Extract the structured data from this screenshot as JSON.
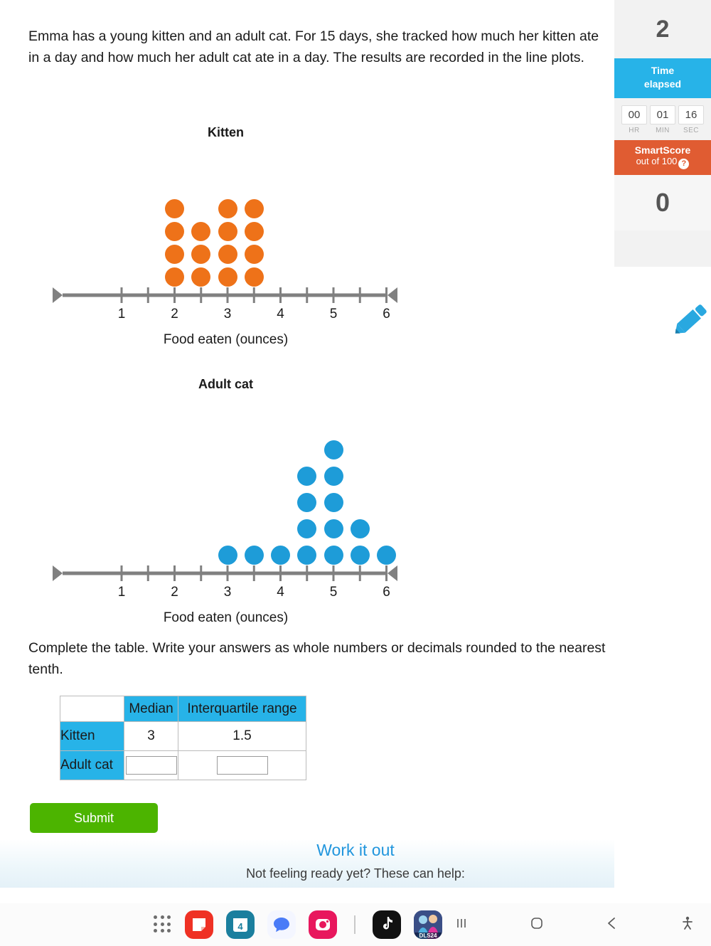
{
  "question": {
    "prompt": "Emma has a young kitten and an adult cat. For 15 days, she tracked how much her kitten ate in a day and how much her adult cat ate in a day. The results are recorded in the line plots.",
    "instruction": "Complete the table. Write your answers as whole numbers or decimals rounded to the nearest tenth."
  },
  "chart_data": [
    {
      "type": "scatter",
      "title": "Kitten",
      "xlabel": "Food eaten (ounces)",
      "ylabel": "",
      "xlim": [
        0.5,
        6.5
      ],
      "tick_labels": [
        "1",
        "2",
        "3",
        "4",
        "5",
        "6"
      ],
      "tick_values": [
        1,
        2,
        3,
        4,
        5,
        6
      ],
      "minor_tick_values": [
        1.5,
        2.5,
        3.5,
        4.5,
        5.5
      ],
      "dot_color": "#ee7219",
      "x": [
        2,
        2.5,
        3,
        3.5
      ],
      "counts": [
        4,
        3,
        4,
        4
      ],
      "total": 15,
      "grid": false,
      "legend": "none"
    },
    {
      "type": "scatter",
      "title": "Adult cat",
      "xlabel": "Food eaten (ounces)",
      "ylabel": "",
      "xlim": [
        0.5,
        6.5
      ],
      "tick_labels": [
        "1",
        "2",
        "3",
        "4",
        "5",
        "6"
      ],
      "tick_values": [
        1,
        2,
        3,
        4,
        5,
        6
      ],
      "minor_tick_values": [
        1.5,
        2.5,
        3.5,
        4.5,
        5.5
      ],
      "dot_color": "#1e9cd8",
      "x": [
        3,
        3.5,
        4,
        4.5,
        5,
        5.5,
        6
      ],
      "counts": [
        1,
        1,
        1,
        4,
        5,
        2,
        1
      ],
      "total": 15,
      "grid": false,
      "legend": "none"
    }
  ],
  "table": {
    "corner": "",
    "columns": [
      "Median",
      "Interquartile range"
    ],
    "rows": [
      {
        "label": "Kitten",
        "median": "3",
        "iqr": "1.5",
        "editable": false
      },
      {
        "label": "Adult cat",
        "median": "",
        "iqr": "",
        "editable": true
      }
    ]
  },
  "actions": {
    "submit_label": "Submit",
    "work_it_out": "Work it out",
    "help_line": "Not feeling ready yet? These can help:"
  },
  "sidebar": {
    "question_number": "2",
    "time_banner_line1": "Time",
    "time_banner_line2": "elapsed",
    "timer": [
      {
        "value": "00",
        "unit": "HR"
      },
      {
        "value": "01",
        "unit": "MIN"
      },
      {
        "value": "16",
        "unit": "SEC"
      }
    ],
    "smartscore_title": "SmartScore",
    "smartscore_sub": "out of 100",
    "smartscore_help": "?",
    "score": "0"
  },
  "pager": {
    "active_color": "#f5c40a",
    "inactive_color": "#dcdcdc"
  },
  "navbar": {
    "apps_icon": "app-grid-icon",
    "items": [
      {
        "name": "samsung-notes-icon",
        "color": "#ef3124"
      },
      {
        "name": "calendar-icon",
        "color": "#1b7f9e",
        "badge": "4"
      },
      {
        "name": "messages-icon",
        "color": "#4a7bf7"
      },
      {
        "name": "instagram-icon",
        "color": "#e8175d"
      },
      {
        "name": "tiktok-icon",
        "color": "#111111"
      },
      {
        "name": "dream-league-soccer-icon",
        "color": "#2b3a6b",
        "label": "DLS24"
      }
    ],
    "system": [
      "recents-icon",
      "home-icon",
      "back-icon",
      "accessibility-icon"
    ]
  }
}
